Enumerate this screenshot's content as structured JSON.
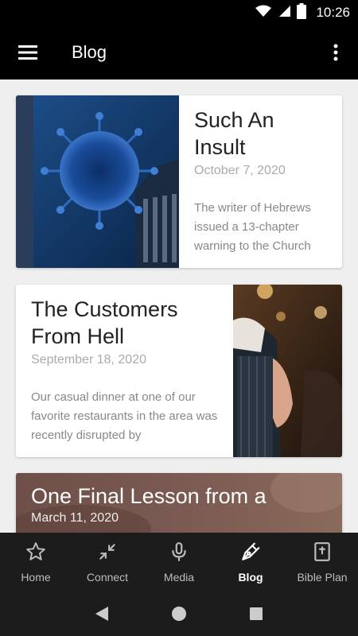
{
  "status_bar": {
    "time": "10:26",
    "icons": [
      "wifi-icon",
      "signal-icon",
      "battery-icon"
    ]
  },
  "app_bar": {
    "title": "Blog",
    "menu_icon": "hamburger-menu-icon",
    "overflow_icon": "more-vertical-icon"
  },
  "posts": [
    {
      "title": "Such An Insult",
      "date": "October 7, 2020",
      "excerpt": "The writer of Hebrews issued a 13-chapter warning to the Church",
      "image": "virus-capitol-image"
    },
    {
      "title": "The Customers From Hell",
      "date": "September 18, 2020",
      "excerpt": "Our casual dinner at one of our favorite restaurants in the area was recently disrupted by",
      "image": "waitress-image"
    },
    {
      "title": "One Final Lesson from a",
      "date": "March 11, 2020",
      "excerpt": "",
      "image": "background-image"
    }
  ],
  "bottom_nav": {
    "items": [
      {
        "label": "Home",
        "icon": "star-icon"
      },
      {
        "label": "Connect",
        "icon": "arrows-in-icon"
      },
      {
        "label": "Media",
        "icon": "microphone-icon"
      },
      {
        "label": "Blog",
        "icon": "pen-nib-icon"
      },
      {
        "label": "Bible Plan",
        "icon": "bible-icon"
      }
    ],
    "active": "Blog"
  },
  "system_nav": {
    "buttons": [
      "back-icon",
      "home-circle-icon",
      "recents-square-icon"
    ]
  }
}
